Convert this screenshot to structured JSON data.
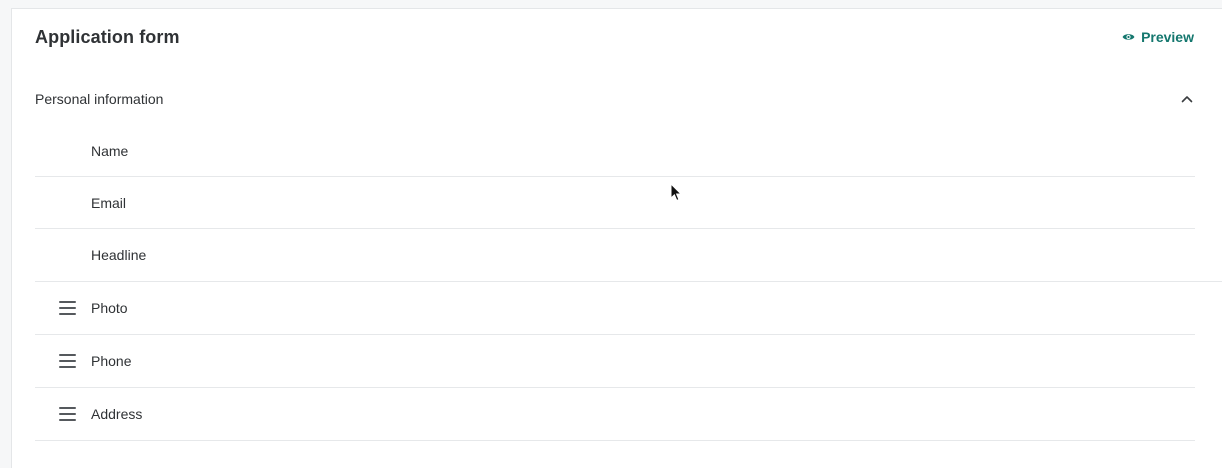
{
  "form": {
    "title": "Application form",
    "preview_label": "Preview"
  },
  "section": {
    "title": "Personal information",
    "expanded": true
  },
  "fields": [
    {
      "label": "Name",
      "draggable": false
    },
    {
      "label": "Email",
      "draggable": false
    },
    {
      "label": "Headline",
      "draggable": false
    },
    {
      "label": "Photo",
      "draggable": true
    },
    {
      "label": "Phone",
      "draggable": true
    },
    {
      "label": "Address",
      "draggable": true
    }
  ],
  "icons": {
    "preview": "eye-icon",
    "section_toggle": "chevron-up-icon",
    "drag": "drag-handle-icon",
    "pointer": "mouse-cursor-icon"
  },
  "colors": {
    "accent": "#14776e",
    "text": "#2f3235",
    "divider": "#e6e8ea"
  }
}
